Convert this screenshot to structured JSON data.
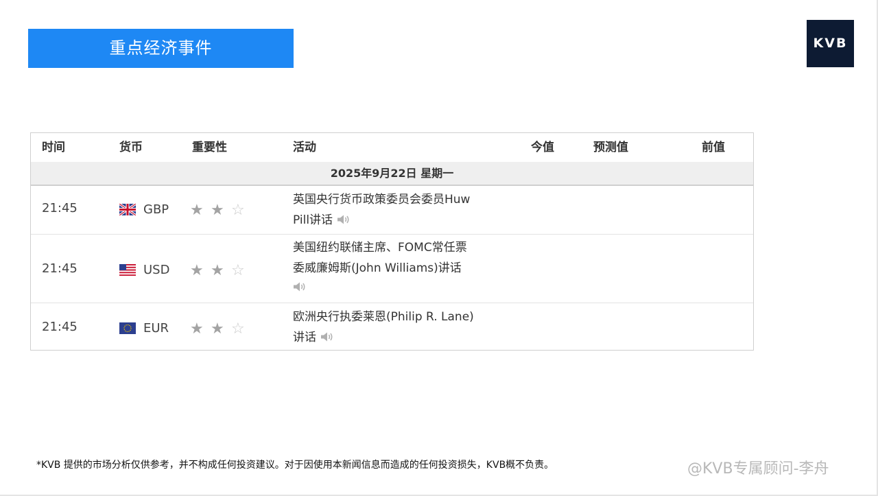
{
  "banner": {
    "title": "重点经济事件"
  },
  "logo": {
    "text": "KVB"
  },
  "table": {
    "headers": {
      "time": "时间",
      "currency": "货币",
      "importance": "重要性",
      "activity": "活动",
      "actual": "今值",
      "forecast": "预测值",
      "previous": "前值"
    },
    "date_label": "2025年9月22日  星期一",
    "rows": [
      {
        "time": "21:45",
        "currency": "GBP",
        "flag": "uk-flag-icon",
        "stars_filled": 2,
        "stars_total": 3,
        "activity_line1": "英国央行货币政策委员会委员Huw",
        "activity_line2": "Pill讲话",
        "actual": "",
        "forecast": "",
        "previous": ""
      },
      {
        "time": "21:45",
        "currency": "USD",
        "flag": "us-flag-icon",
        "stars_filled": 2,
        "stars_total": 3,
        "activity_line1": "美国纽约联储主席、FOMC常任票",
        "activity_line2": "委威廉姆斯(John Williams)讲话",
        "actual": "",
        "forecast": "",
        "previous": ""
      },
      {
        "time": "21:45",
        "currency": "EUR",
        "flag": "eu-flag-icon",
        "stars_filled": 2,
        "stars_total": 3,
        "activity_line1": "欧洲央行执委莱恩(Philip R. Lane)",
        "activity_line2": "讲话",
        "actual": "",
        "forecast": "",
        "previous": ""
      }
    ],
    "icons": {
      "star": "star-icon",
      "audio": "speaker-icon"
    },
    "colors": {
      "star_on": "#a3a3a3",
      "star_off": "#c9c9c9"
    }
  },
  "footer": {
    "disclaimer": "*KVB 提供的市场分析仅供参考，并不构成任何投资建议。对于因使用本新闻信息而造成的任何投资损失，KVB概不负责。",
    "watermark": "@KVB专属顾问-李舟"
  },
  "colors": {
    "banner": "#1e88f4",
    "logo_bg": "#0d1b33"
  }
}
